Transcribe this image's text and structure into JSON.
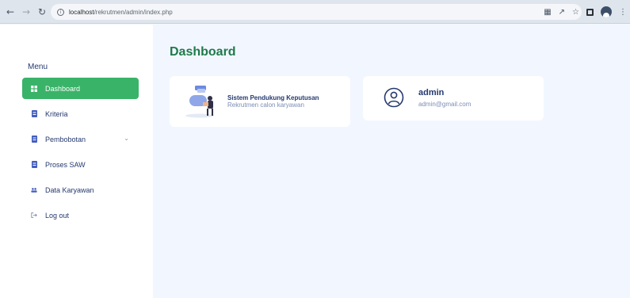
{
  "browser": {
    "url_host": "localhost",
    "url_path": "/rekrutmen/admin/index.php"
  },
  "sidebar": {
    "menu_title": "Menu",
    "items": [
      {
        "label": "Dashboard",
        "icon": "grid-icon",
        "active": true
      },
      {
        "label": "Kriteria",
        "icon": "file-icon"
      },
      {
        "label": "Pembobotan",
        "icon": "file-icon",
        "has_submenu": true
      },
      {
        "label": "Proses SAW",
        "icon": "file-icon"
      },
      {
        "label": "Data Karyawan",
        "icon": "people-icon"
      },
      {
        "label": "Log out",
        "icon": "logout-icon"
      }
    ]
  },
  "main": {
    "title": "Dashboard",
    "card_system": {
      "title": "Sistem Pendukung Keputusan",
      "subtitle": "Rekrutmen calon karyawan"
    },
    "card_user": {
      "name": "admin",
      "email": "admin@gmail.com"
    }
  },
  "colors": {
    "accent": "#39b368",
    "title_green": "#1f7a4a",
    "text_navy": "#25396f",
    "muted": "#7c8db5",
    "background": "#f2f7ff"
  }
}
